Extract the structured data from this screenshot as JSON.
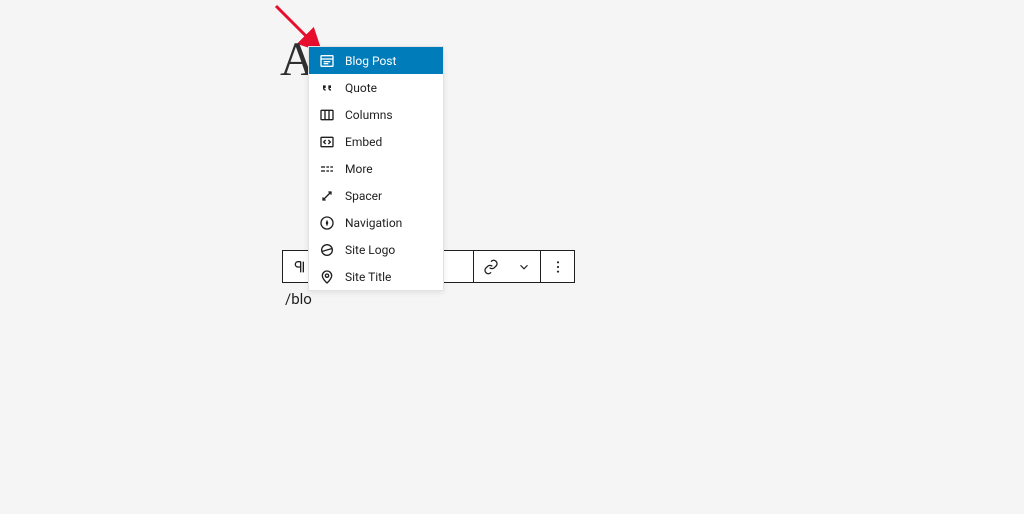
{
  "colors": {
    "accent": "#007cba",
    "annotation": "#e70d2d"
  },
  "drop_cap": "A",
  "typed_text": "/blo",
  "toolbar": {
    "paragraph_tooltip": "Paragraph",
    "link_tooltip": "Link",
    "dropdown_tooltip": "More",
    "options_tooltip": "Options"
  },
  "popup": {
    "items": [
      {
        "icon": "blog-post-icon",
        "label": "Blog Post",
        "selected": true
      },
      {
        "icon": "quote-icon",
        "label": "Quote",
        "selected": false
      },
      {
        "icon": "columns-icon",
        "label": "Columns",
        "selected": false
      },
      {
        "icon": "embed-icon",
        "label": "Embed",
        "selected": false
      },
      {
        "icon": "more-icon",
        "label": "More",
        "selected": false
      },
      {
        "icon": "spacer-icon",
        "label": "Spacer",
        "selected": false
      },
      {
        "icon": "navigation-icon",
        "label": "Navigation",
        "selected": false
      },
      {
        "icon": "site-logo-icon",
        "label": "Site Logo",
        "selected": false
      },
      {
        "icon": "site-title-icon",
        "label": "Site Title",
        "selected": false
      }
    ]
  }
}
